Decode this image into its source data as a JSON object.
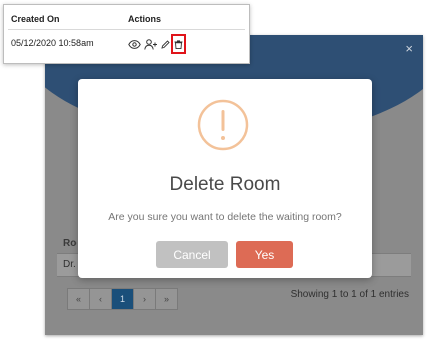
{
  "callout": {
    "col_created_on": "Created On",
    "col_actions": "Actions",
    "date_value": "05/12/2020 10:58am",
    "actions": [
      "eye-icon",
      "user-plus-icon",
      "pencil-icon",
      "trash-icon"
    ]
  },
  "background_modal": {
    "close_glyph": "×",
    "column_header_partial": "Roo",
    "row_text_partial": "Dr. I",
    "pagination": {
      "first": "«",
      "prev": "‹",
      "current_page": "1",
      "next": "›",
      "last": "»"
    },
    "entries_text": "Showing 1 to 1 of 1 entries"
  },
  "dialog": {
    "icon": "warning-icon",
    "title": "Delete Room",
    "message": "Are you sure you want to delete the waiting room?",
    "cancel_label": "Cancel",
    "confirm_label": "Yes"
  },
  "colors": {
    "modal_header": "#2e4f74",
    "warning_icon": "#f3c299",
    "cancel_button": "#c1c1c1",
    "confirm_button": "#dd6b55",
    "highlight_box": "#e0141a",
    "active_page": "#1a4f7a"
  }
}
